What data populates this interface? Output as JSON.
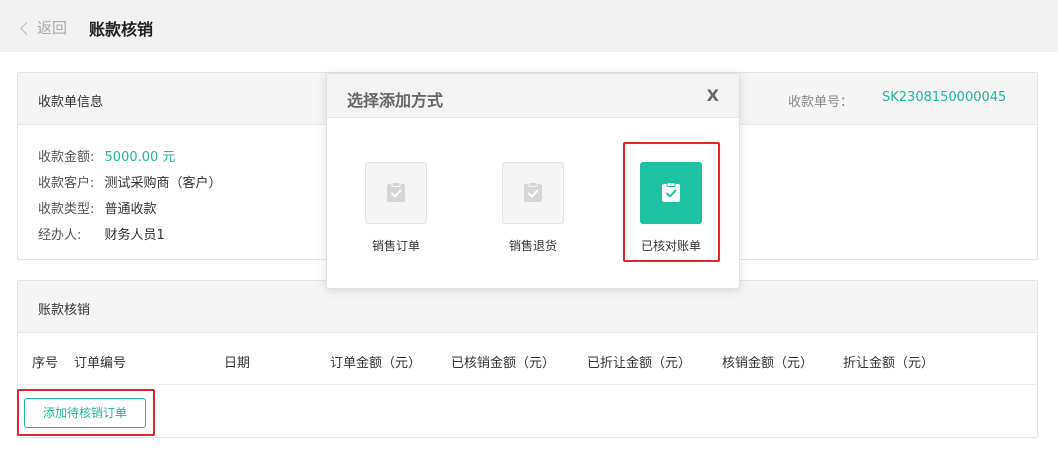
{
  "header": {
    "back_label": "返回",
    "page_title": "账款核销"
  },
  "receipt": {
    "section_title": "收款单信息",
    "sn_label": "收款单号：",
    "sn_value": "SK2308150000045",
    "amount_label": "收款金额:",
    "amount_value": "5000.00 元",
    "customer_label": "收款客户:",
    "customer_value": "测试采购商（客户）",
    "type_label": "收款类型:",
    "type_value": "普通收款",
    "handler_label": "经办人:",
    "handler_value": "财务人员1"
  },
  "writeoff": {
    "section_title": "账款核销",
    "columns": [
      "序号",
      "订单编号",
      "日期",
      "订单金额（元）",
      "已核销金额（元）",
      "已折让金额（元）",
      "核销金额（元）",
      "折让金额（元）"
    ],
    "add_button": "添加待核销订单"
  },
  "modal": {
    "title": "选择添加方式",
    "close": "X",
    "options": [
      {
        "label": "销售订单",
        "active": false
      },
      {
        "label": "销售退货",
        "active": false
      },
      {
        "label": "已核对账单",
        "active": true
      }
    ]
  },
  "colors": {
    "accent": "#1fb89d",
    "active_tile": "#1fc3a1",
    "highlight_box": "#e0262a"
  }
}
